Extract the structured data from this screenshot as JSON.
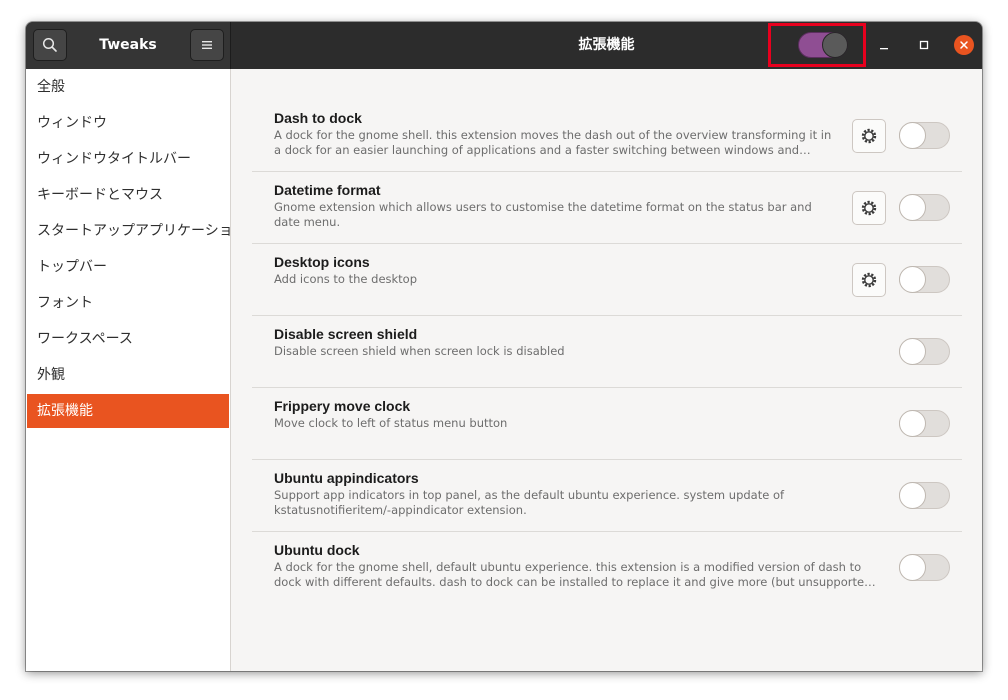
{
  "app": {
    "title": "Tweaks",
    "panel_title": "拡張機能",
    "search_icon": "search-icon",
    "menu_icon": "hamburger-menu-icon",
    "extensions_master_switch": "on",
    "accent_color": "#e95420",
    "switch_on_color": "#8f4e93"
  },
  "window_controls": {
    "minimize_icon": "minimize-icon",
    "maximize_icon": "maximize-icon",
    "close_icon": "close-icon"
  },
  "sidebar": {
    "items": [
      {
        "label": "全般"
      },
      {
        "label": "ウィンドウ"
      },
      {
        "label": "ウィンドウタイトルバー"
      },
      {
        "label": "キーボードとマウス"
      },
      {
        "label": "スタートアップアプリケーション"
      },
      {
        "label": "トップバー"
      },
      {
        "label": "フォント"
      },
      {
        "label": "ワークスペース"
      },
      {
        "label": "外観"
      },
      {
        "label": "拡張機能",
        "active": true
      }
    ]
  },
  "extensions": [
    {
      "name": "Dash to dock",
      "description": "A dock for the gnome shell. this extension moves the dash out of the overview transforming it in a dock for an easier launching of applications and a faster switching between windows and desktops. Side and bottom placement options are available.",
      "has_settings": true,
      "enabled": false
    },
    {
      "name": "Datetime format",
      "description": "Gnome extension which allows users to customise the datetime format on the status bar and date menu.",
      "has_settings": true,
      "enabled": false
    },
    {
      "name": "Desktop icons",
      "description": "Add icons to the desktop",
      "has_settings": true,
      "enabled": false
    },
    {
      "name": "Disable screen shield",
      "description": "Disable screen shield when screen lock is disabled",
      "has_settings": false,
      "enabled": false
    },
    {
      "name": "Frippery move clock",
      "description": "Move clock to left of status menu button",
      "has_settings": false,
      "enabled": false
    },
    {
      "name": "Ubuntu appindicators",
      "description": "Support app indicators in top panel, as the default ubuntu experience. system update of kstatusnotifieritem/-appindicator extension.",
      "has_settings": false,
      "enabled": false
    },
    {
      "name": "Ubuntu dock",
      "description": "A dock for the gnome shell, default ubuntu experience. this extension is a modified version of dash to dock with different defaults. dash to dock can be installed to replace it and give more (but unsupported) configuration options.",
      "has_settings": false,
      "enabled": false
    }
  ]
}
